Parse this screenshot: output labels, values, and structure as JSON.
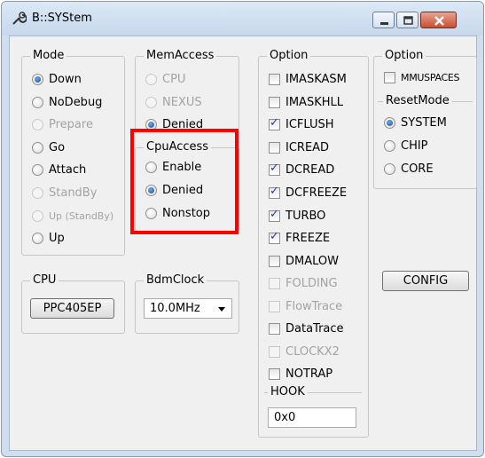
{
  "window": {
    "title": "B::SYStem"
  },
  "mode": {
    "legend": "Mode",
    "options": [
      {
        "label": "Down",
        "selected": true,
        "disabled": false
      },
      {
        "label": "NoDebug",
        "selected": false,
        "disabled": false
      },
      {
        "label": "Prepare",
        "selected": false,
        "disabled": true
      },
      {
        "label": "Go",
        "selected": false,
        "disabled": false
      },
      {
        "label": "Attach",
        "selected": false,
        "disabled": false
      },
      {
        "label": "StandBy",
        "selected": false,
        "disabled": true
      },
      {
        "label": "Up (StandBy)",
        "selected": false,
        "disabled": true
      },
      {
        "label": "Up",
        "selected": false,
        "disabled": false
      }
    ]
  },
  "memaccess": {
    "legend": "MemAccess",
    "options": [
      {
        "label": "CPU",
        "selected": false,
        "disabled": true
      },
      {
        "label": "NEXUS",
        "selected": false,
        "disabled": true
      },
      {
        "label": "Denied",
        "selected": true,
        "disabled": false
      }
    ]
  },
  "cpuaccess": {
    "legend": "CpuAccess",
    "options": [
      {
        "label": "Enable",
        "selected": false,
        "disabled": false
      },
      {
        "label": "Denied",
        "selected": true,
        "disabled": false
      },
      {
        "label": "Nonstop",
        "selected": false,
        "disabled": false
      }
    ]
  },
  "option": {
    "legend": "Option",
    "checks": [
      {
        "label": "IMASKASM",
        "checked": false,
        "disabled": false
      },
      {
        "label": "IMASKHLL",
        "checked": false,
        "disabled": false
      },
      {
        "label": "ICFLUSH",
        "checked": true,
        "disabled": false
      },
      {
        "label": "ICREAD",
        "checked": false,
        "disabled": false
      },
      {
        "label": "DCREAD",
        "checked": true,
        "disabled": false
      },
      {
        "label": "DCFREEZE",
        "checked": true,
        "disabled": false
      },
      {
        "label": "TURBO",
        "checked": true,
        "disabled": false
      },
      {
        "label": "FREEZE",
        "checked": true,
        "disabled": false
      },
      {
        "label": "DMALOW",
        "checked": false,
        "disabled": false
      },
      {
        "label": "FOLDING",
        "checked": false,
        "disabled": true
      },
      {
        "label": "FlowTrace",
        "checked": false,
        "disabled": true
      },
      {
        "label": "DataTrace",
        "checked": false,
        "disabled": false
      },
      {
        "label": "CLOCKX2",
        "checked": false,
        "disabled": true
      },
      {
        "label": "NOTRAP",
        "checked": false,
        "disabled": false
      }
    ],
    "hook": {
      "legend": "HOOK",
      "value": "0x0"
    }
  },
  "option2": {
    "legend": "Option",
    "mmuspaces": {
      "label": "MMUSPACES",
      "checked": false
    },
    "resetmode": {
      "legend": "ResetMode",
      "options": [
        {
          "label": "SYSTEM",
          "selected": true
        },
        {
          "label": "CHIP",
          "selected": false
        },
        {
          "label": "CORE",
          "selected": false
        }
      ]
    }
  },
  "cpu": {
    "legend": "CPU",
    "value": "PPC405EP"
  },
  "bdmclock": {
    "legend": "BdmClock",
    "value": "10.0MHz"
  },
  "config_button": "CONFIG",
  "highlight_color": "#ff0000"
}
